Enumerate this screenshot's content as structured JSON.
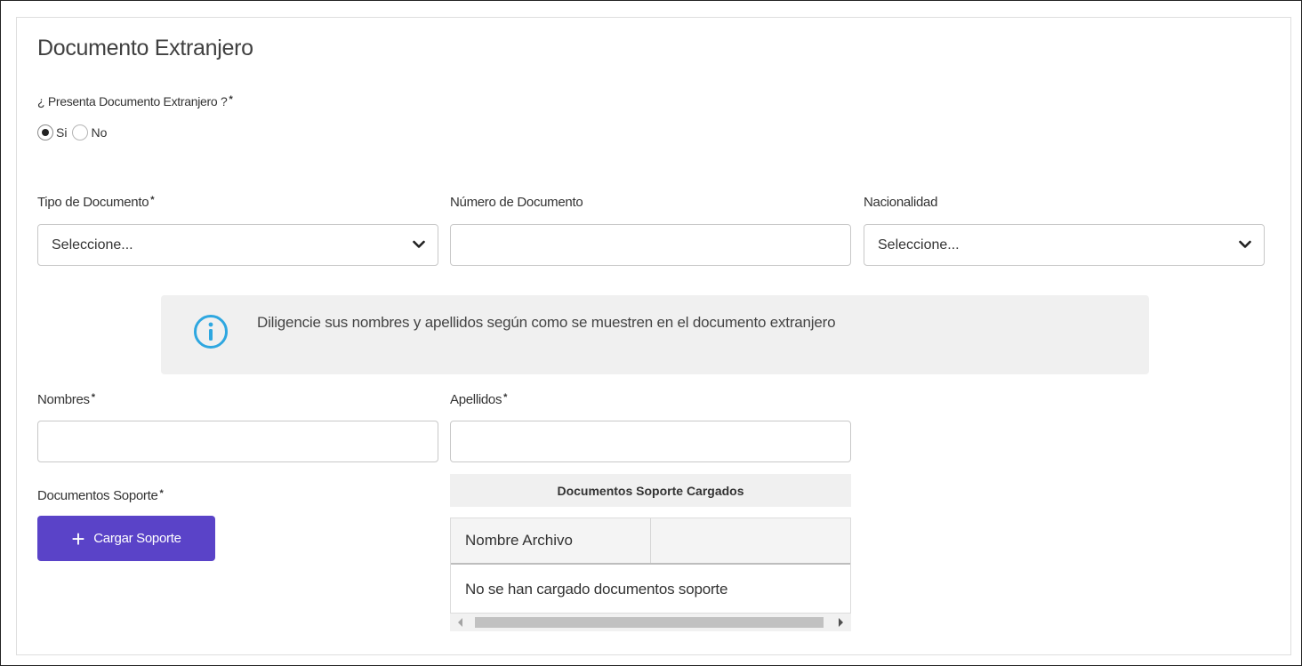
{
  "section": {
    "title": "Documento Extranjero"
  },
  "question": {
    "label": "¿ Presenta Documento Extranjero ?",
    "required_mark": "*",
    "options": [
      {
        "label": "Si",
        "checked": true
      },
      {
        "label": "No",
        "checked": false
      }
    ]
  },
  "fields": {
    "tipo_documento": {
      "label": "Tipo de Documento",
      "required_mark": "*",
      "value": "Seleccione..."
    },
    "numero_documento": {
      "label": "Número de Documento",
      "value": ""
    },
    "nacionalidad": {
      "label": "Nacionalidad",
      "value": "Seleccione..."
    },
    "nombres": {
      "label": "Nombres",
      "required_mark": "*",
      "value": ""
    },
    "apellidos": {
      "label": "Apellidos",
      "required_mark": "*",
      "value": ""
    }
  },
  "info": {
    "icon": "info-icon",
    "text": "Diligencie sus nombres y apellidos según como se muestren en el documento extranjero"
  },
  "soporte": {
    "label": "Documentos Soporte",
    "required_mark": "*",
    "button_label": "Cargar Soporte",
    "button_icon": "plus-icon",
    "table": {
      "caption": "Documentos Soporte Cargados",
      "columns": [
        "Nombre Archivo",
        ""
      ],
      "empty_message": "No se han cargado documentos soporte"
    }
  },
  "colors": {
    "accent": "#5a43c8",
    "info_icon": "#2ea7e0",
    "info_bg": "#f0f0f0"
  }
}
